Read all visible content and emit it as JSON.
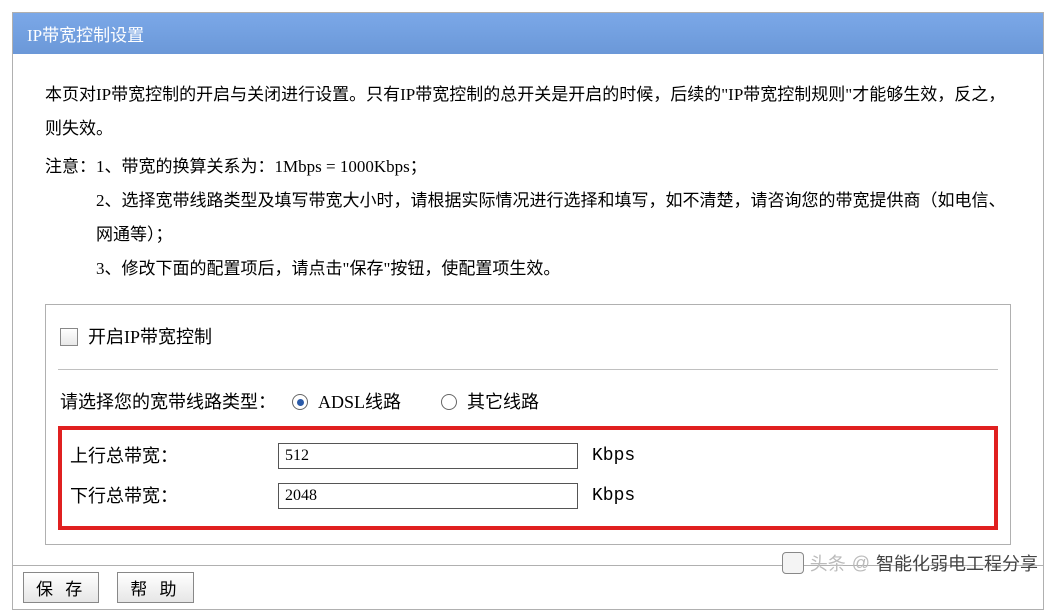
{
  "title": "IP带宽控制设置",
  "intro": "本页对IP带宽控制的开启与关闭进行设置。只有IP带宽控制的总开关是开启的时候，后续的\"IP带宽控制规则\"才能够生效，反之，则失效。",
  "notes": {
    "label": "注意：",
    "item1": "1、带宽的换算关系为：1Mbps = 1000Kbps；",
    "item2": "2、选择宽带线路类型及填写带宽大小时，请根据实际情况进行选择和填写，如不清楚，请咨询您的带宽提供商（如电信、网通等）；",
    "item3": "3、修改下面的配置项后，请点击\"保存\"按钮，使配置项生效。"
  },
  "settings": {
    "enable_label": "开启IP带宽控制",
    "line_type_label": "请选择您的宽带线路类型：",
    "radio_adsl": "ADSL线路",
    "radio_other": "其它线路",
    "upstream_label": "上行总带宽：",
    "upstream_value": "512",
    "downstream_label": "下行总带宽：",
    "downstream_value": "2048",
    "unit": "Kbps"
  },
  "buttons": {
    "save": "保 存",
    "help": "帮 助"
  },
  "watermark": {
    "prefix": "头条",
    "at": "@",
    "name": "智能化弱电工程分享"
  }
}
